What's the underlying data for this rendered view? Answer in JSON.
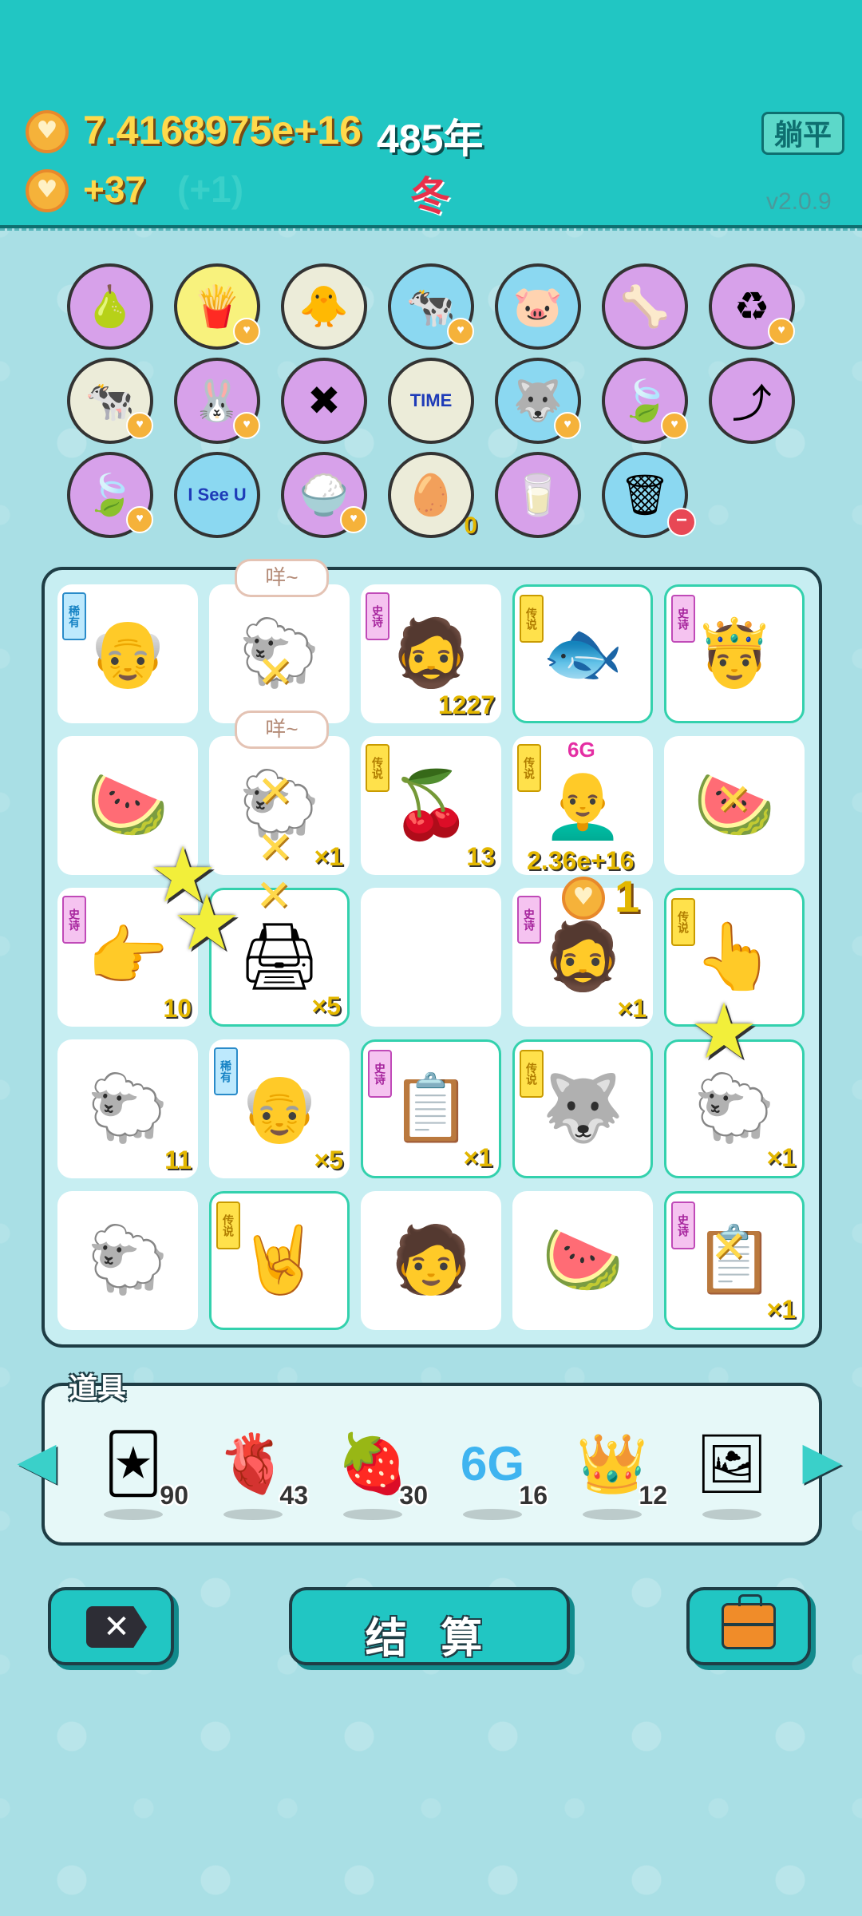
{
  "header": {
    "money": "7.4168975e+16",
    "year": "485年",
    "rate": "+37",
    "rate_sub": "(+1)",
    "season": "冬",
    "liedown_button": "躺平",
    "version": "v2.0.9"
  },
  "collection": {
    "items": [
      {
        "name": "pomelo-grapefruit",
        "icon": "🍐"
      },
      {
        "name": "french-fries",
        "icon": "🍟"
      },
      {
        "name": "chick-egg",
        "icon": "🐥"
      },
      {
        "name": "cow-pair",
        "icon": "🐄"
      },
      {
        "name": "piggy-bank",
        "icon": "🐷"
      },
      {
        "name": "pet-food",
        "icon": "🦴"
      },
      {
        "name": "recycle",
        "icon": "♻"
      },
      {
        "name": "cow-pair-2",
        "icon": "🐄"
      },
      {
        "name": "rabbit",
        "icon": "🐰"
      },
      {
        "name": "multiplier-guy",
        "icon": "✖"
      },
      {
        "name": "time-magazine",
        "icon": "TIME"
      },
      {
        "name": "husky-dog",
        "icon": "🐺"
      },
      {
        "name": "leaf",
        "icon": "🍃"
      },
      {
        "name": "curved-arrow",
        "icon": "⤴"
      },
      {
        "name": "leaf-2",
        "icon": "🍃"
      },
      {
        "name": "i-see-u",
        "icon": "I See U"
      },
      {
        "name": "rice-bowl",
        "icon": "🍚"
      },
      {
        "name": "egg-tray",
        "icon": "🥚",
        "count": "0"
      },
      {
        "name": "milk-jar",
        "icon": "🥛"
      },
      {
        "name": "trash-bag",
        "icon": "🗑"
      }
    ]
  },
  "board": {
    "cells": [
      {
        "row": 0,
        "col": 0,
        "tag": "稀有",
        "icon": "👴",
        "count": ""
      },
      {
        "row": 0,
        "col": 1,
        "tag": "",
        "icon": "🐑",
        "count": "",
        "bubble": "咩~"
      },
      {
        "row": 0,
        "col": 2,
        "tag": "史诗",
        "icon": "🧔",
        "count": "1227"
      },
      {
        "row": 0,
        "col": 3,
        "tag": "传说",
        "icon": "🐟",
        "count": ""
      },
      {
        "row": 0,
        "col": 4,
        "tag": "史诗",
        "icon": "🤴",
        "count": ""
      },
      {
        "row": 1,
        "col": 0,
        "tag": "",
        "icon": "🍉",
        "count": ""
      },
      {
        "row": 1,
        "col": 1,
        "tag": "",
        "icon": "🐑",
        "count": "×1",
        "bubble": "咩~"
      },
      {
        "row": 1,
        "col": 2,
        "tag": "传说",
        "icon": "🍒",
        "count": "13"
      },
      {
        "row": 1,
        "col": 3,
        "tag": "传说",
        "icon": "👨‍🦲",
        "count": "",
        "above": "6G",
        "big": "2.36e+16"
      },
      {
        "row": 1,
        "col": 4,
        "tag": "",
        "icon": "🍉",
        "count": ""
      },
      {
        "row": 2,
        "col": 0,
        "tag": "史诗",
        "icon": "👉",
        "count": "10"
      },
      {
        "row": 2,
        "col": 1,
        "tag": "",
        "icon": "🖨",
        "count": "×5"
      },
      {
        "row": 2,
        "col": 2,
        "tag": "",
        "icon": "",
        "count": ""
      },
      {
        "row": 2,
        "col": 3,
        "tag": "史诗",
        "icon": "🧔",
        "count": "×1",
        "plus": "1"
      },
      {
        "row": 2,
        "col": 4,
        "tag": "传说",
        "icon": "👆",
        "count": ""
      },
      {
        "row": 3,
        "col": 0,
        "tag": "",
        "icon": "🐑",
        "count": "11"
      },
      {
        "row": 3,
        "col": 1,
        "tag": "稀有",
        "icon": "👴",
        "count": "×5"
      },
      {
        "row": 3,
        "col": 2,
        "tag": "史诗",
        "icon": "📋",
        "count": "×1"
      },
      {
        "row": 3,
        "col": 3,
        "tag": "传说",
        "icon": "🐺",
        "count": ""
      },
      {
        "row": 3,
        "col": 4,
        "tag": "",
        "icon": "🐑",
        "count": "×1"
      },
      {
        "row": 4,
        "col": 0,
        "tag": "",
        "icon": "🐑",
        "count": ""
      },
      {
        "row": 4,
        "col": 1,
        "tag": "传说",
        "icon": "🤘",
        "count": ""
      },
      {
        "row": 4,
        "col": 2,
        "tag": "",
        "icon": "🧑",
        "count": ""
      },
      {
        "row": 4,
        "col": 3,
        "tag": "",
        "icon": "🍉",
        "count": ""
      },
      {
        "row": 4,
        "col": 4,
        "tag": "史诗",
        "icon": "📋",
        "count": "×1"
      }
    ]
  },
  "props": {
    "title": "道具",
    "items": [
      {
        "name": "rare-cards",
        "icon": "🃏",
        "count": "90"
      },
      {
        "name": "liver",
        "icon": "🫀",
        "count": "43"
      },
      {
        "name": "strawberry",
        "icon": "🍓",
        "count": "30"
      },
      {
        "name": "6g",
        "icon": "6G",
        "count": "16"
      },
      {
        "name": "crown",
        "icon": "👑",
        "count": "12"
      },
      {
        "name": "frame",
        "icon": "🖼",
        "count": ""
      }
    ]
  },
  "buttons": {
    "settle": "结 算"
  },
  "colors": {
    "header_bg": "#21c6c3",
    "body_bg": "#a9dfe5",
    "legend_tag": "#ffe14b",
    "epic_tag": "#f5c3f0",
    "rare_tag": "#bde9fd"
  }
}
